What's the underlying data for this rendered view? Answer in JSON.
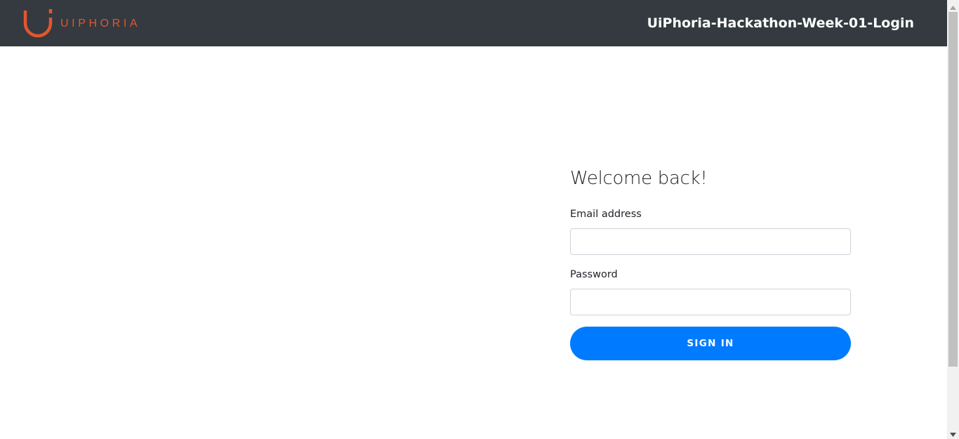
{
  "navbar": {
    "logo_text": "UIPHORIA",
    "title": "UiPhoria-Hackathon-Week-01-Login"
  },
  "login": {
    "heading": "Welcome back!",
    "email_label": "Email address",
    "email_value": "",
    "password_label": "Password",
    "password_value": "",
    "submit_label": "SIGN IN"
  },
  "colors": {
    "navbar_bg": "#343a40",
    "brand_accent": "#e4552f",
    "primary_button": "#007bff"
  },
  "icons": {
    "logo": "uiphoria-logo-icon",
    "scroll_up": "chevron-up-icon",
    "scroll_down": "chevron-down-icon"
  }
}
